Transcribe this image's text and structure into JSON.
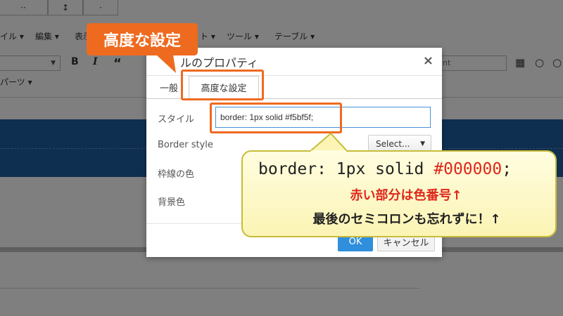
{
  "toolbar": {
    "top_cells": [
      "··",
      "↕",
      "·"
    ],
    "menu": [
      "イル ▾",
      "編集 ▾",
      "表示",
      "ト ▾",
      "ツール ▾",
      "テーブル ▾"
    ],
    "format_buttons": [
      "B",
      "I",
      "“"
    ],
    "right_select_text": "nt",
    "parts_menu": "パーツ ▾"
  },
  "dialog": {
    "title": "ルのプロパティ",
    "close": "×",
    "tabs": [
      "一般",
      "高度な設定"
    ],
    "fields": [
      {
        "label": "スタイル"
      },
      {
        "label": "Border style"
      },
      {
        "label": "枠線の色"
      },
      {
        "label": "背景色"
      }
    ],
    "style_value": "border: 1px solid #f5bf5f;",
    "select_label": "Select...",
    "ok": "OK",
    "cancel": "キャンセル"
  },
  "annotation": {
    "badge": "高度な設定",
    "code_prefix": "border: 1px solid ",
    "code_color": "#000000",
    "code_suffix": ";",
    "note_red": "赤い部分は色番号↑",
    "note_black": "最後のセミコロンも忘れずに！↑"
  },
  "colors": {
    "accent_orange": "#ee6a1f",
    "highlight_red": "#e0261a",
    "ok_blue": "#2f8fdc",
    "band_blue": "#1f5ea3"
  }
}
